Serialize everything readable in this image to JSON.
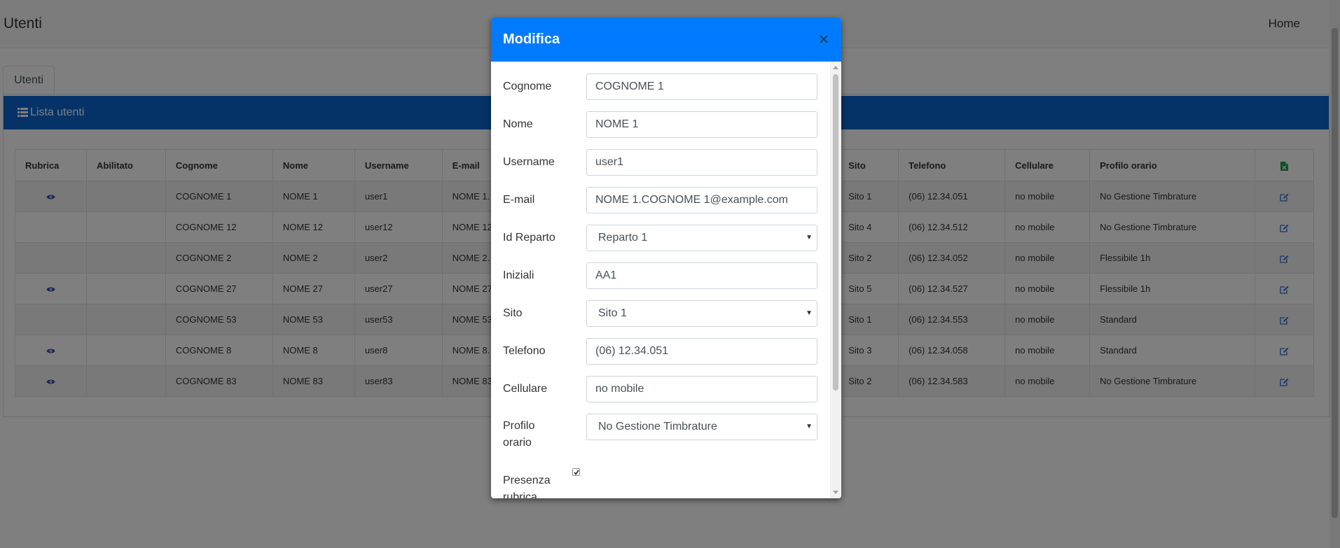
{
  "navbar": {
    "title": "Utenti",
    "home_label": "Home"
  },
  "tabs": [
    {
      "label": "Utenti"
    }
  ],
  "panel": {
    "title": "Lista utenti"
  },
  "table": {
    "headers": {
      "rubrica": "Rubrica",
      "abilitato": "Abilitato",
      "cognome": "Cognome",
      "nome": "Nome",
      "username": "Username",
      "email": "E-mail",
      "sito": "Sito",
      "telefono": "Telefono",
      "cellulare": "Cellulare",
      "profilo": "Profilo orario"
    },
    "rows": [
      {
        "rubrica_icon": true,
        "cognome": "COGNOME 1",
        "nome": "NOME 1",
        "username": "user1",
        "email": "NOME 1.",
        "sito": "Sito 1",
        "telefono": "(06) 12.34.051",
        "cellulare": "no mobile",
        "profilo": "No Gestione Timbrature"
      },
      {
        "rubrica_icon": false,
        "cognome": "COGNOME 12",
        "nome": "NOME 12",
        "username": "user12",
        "email": "NOME 12",
        "sito": "Sito 4",
        "telefono": "(06) 12.34.512",
        "cellulare": "no mobile",
        "profilo": "No Gestione Timbrature"
      },
      {
        "rubrica_icon": false,
        "cognome": "COGNOME 2",
        "nome": "NOME 2",
        "username": "user2",
        "email": "NOME 2.",
        "sito": "Sito 2",
        "telefono": "(06) 12.34.052",
        "cellulare": "no mobile",
        "profilo": "Flessibile 1h"
      },
      {
        "rubrica_icon": true,
        "cognome": "COGNOME 27",
        "nome": "NOME 27",
        "username": "user27",
        "email": "NOME 27",
        "sito": "Sito 5",
        "telefono": "(06) 12.34.527",
        "cellulare": "no mobile",
        "profilo": "Flessibile 1h"
      },
      {
        "rubrica_icon": false,
        "cognome": "COGNOME 53",
        "nome": "NOME 53",
        "username": "user53",
        "email": "NOME 53",
        "sito": "Sito 1",
        "telefono": "(06) 12.34.553",
        "cellulare": "no mobile",
        "profilo": "Standard"
      },
      {
        "rubrica_icon": true,
        "cognome": "COGNOME 8",
        "nome": "NOME 8",
        "username": "user8",
        "email": "NOME 8.",
        "sito": "Sito 3",
        "telefono": "(06) 12.34.058",
        "cellulare": "no mobile",
        "profilo": "Standard"
      },
      {
        "rubrica_icon": true,
        "cognome": "COGNOME 83",
        "nome": "NOME 83",
        "username": "user83",
        "email": "NOME 83",
        "sito": "Sito 2",
        "telefono": "(06) 12.34.583",
        "cellulare": "no mobile",
        "profilo": "No Gestione Timbrature"
      }
    ]
  },
  "modal": {
    "title": "Modifica",
    "fields": {
      "cognome": {
        "label": "Cognome",
        "value": "COGNOME 1"
      },
      "nome": {
        "label": "Nome",
        "value": "NOME 1"
      },
      "username": {
        "label": "Username",
        "value": "user1"
      },
      "email": {
        "label": "E-mail",
        "value": "NOME 1.COGNOME 1@example.com"
      },
      "reparto": {
        "label": "Id Reparto",
        "value": "Reparto 1"
      },
      "iniziali": {
        "label": "Iniziali",
        "value": "AA1"
      },
      "sito": {
        "label": "Sito",
        "value": "Sito 1"
      },
      "telefono": {
        "label": "Telefono",
        "value": "(06) 12.34.051"
      },
      "cellulare": {
        "label": "Cellulare",
        "value": "no mobile"
      },
      "profilo": {
        "label_line1": "Profilo",
        "label_line2": "orario",
        "value": "No Gestione Timbrature"
      },
      "presenza": {
        "label_line1": "Presenza",
        "label_line2": "rubrica",
        "checked": true
      }
    }
  },
  "colors": {
    "navbar_bg": "#f8f9fa",
    "panel_header": "#0b66d0",
    "modal_header": "#007bff",
    "icon_blue": "#2a6fd6",
    "excel_green": "#1e9e4a"
  },
  "icons": {
    "list": "list-icon",
    "eye": "eye-icon",
    "edit": "edit-icon",
    "excel": "excel-file-icon",
    "close": "close-icon"
  }
}
